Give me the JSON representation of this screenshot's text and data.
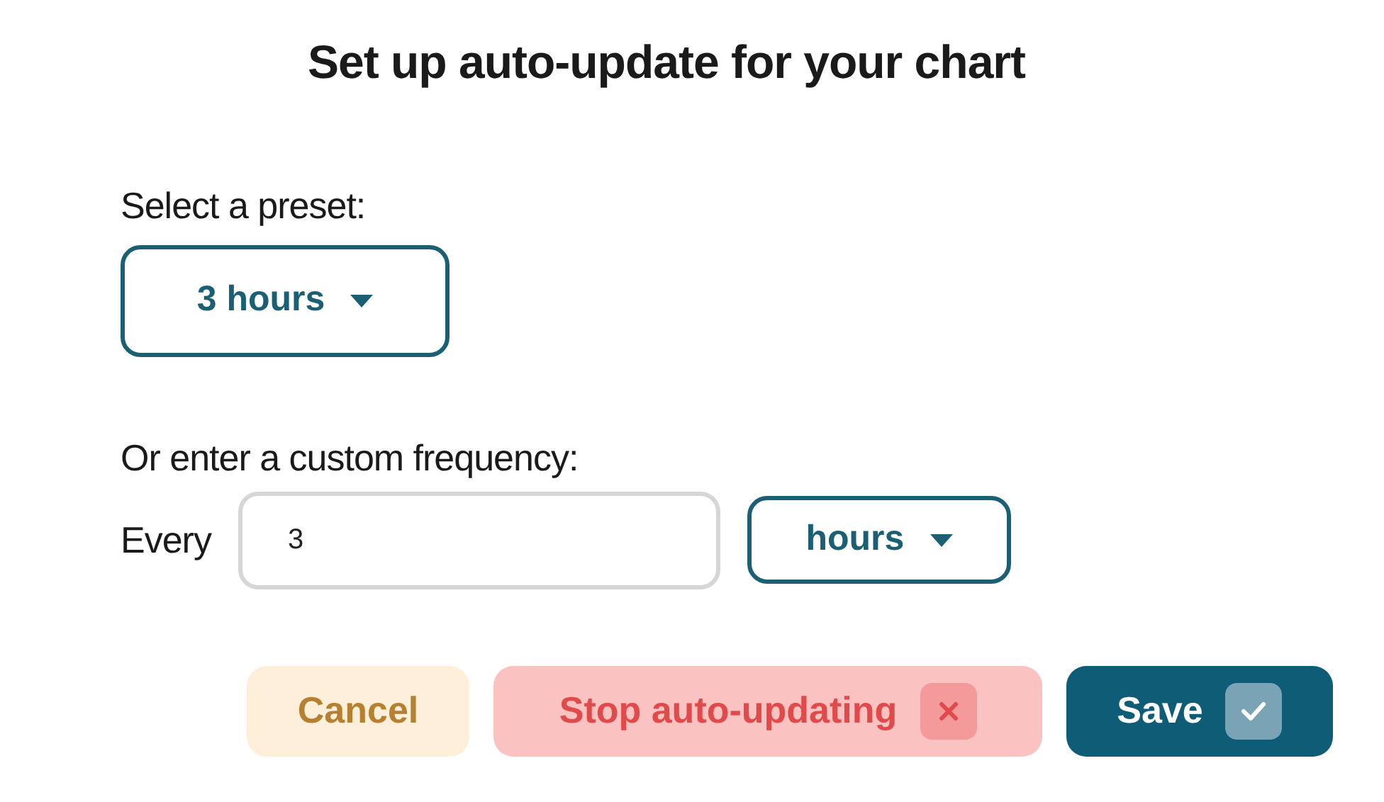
{
  "title": "Set up auto-update for your chart",
  "preset": {
    "label": "Select a preset:",
    "value": "3 hours"
  },
  "custom": {
    "label": "Or enter a custom frequency:",
    "prefix": "Every",
    "value": "3",
    "unit": "hours"
  },
  "buttons": [
    {
      "kind": "cancel",
      "label": "Cancel"
    },
    {
      "kind": "stop",
      "label": "Stop auto-updating"
    },
    {
      "kind": "save",
      "label": "Save"
    }
  ]
}
